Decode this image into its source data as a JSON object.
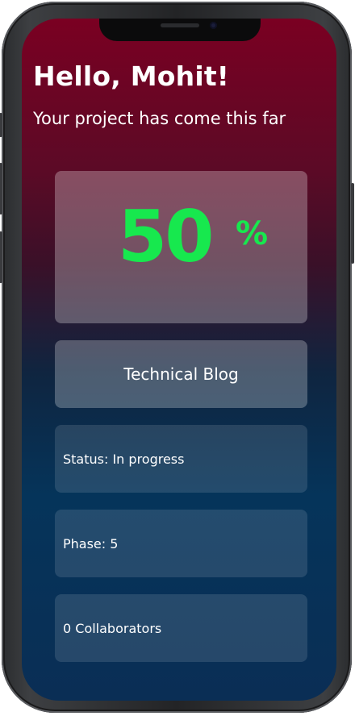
{
  "header": {
    "greeting": "Hello, Mohit!",
    "subtitle": "Your project has come this far"
  },
  "progress": {
    "value": "50",
    "unit": "%",
    "fraction": 0.5,
    "color": "#17e84e"
  },
  "project": {
    "name": "Technical Blog"
  },
  "details": {
    "status": "Status: In progress",
    "phase": "Phase: 5",
    "collaborators": "0 Collaborators"
  }
}
